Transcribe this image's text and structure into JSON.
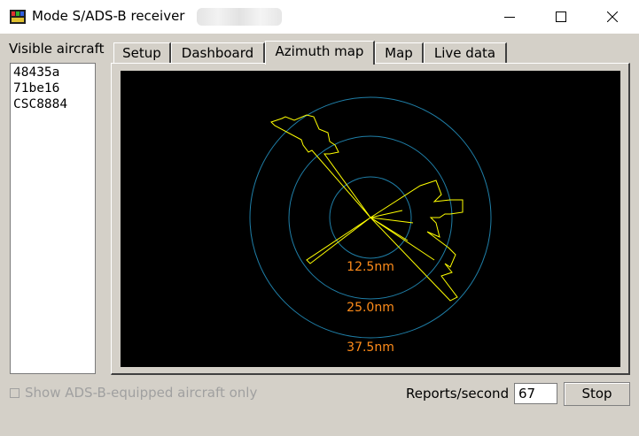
{
  "window": {
    "title": "Mode S/ADS-B receiver",
    "controls": [
      "minimize",
      "maximize",
      "close"
    ]
  },
  "sidebar": {
    "label": "Visible aircraft",
    "aircraft": [
      "48435a",
      "71be16",
      "CSC8884"
    ]
  },
  "tabs": [
    {
      "label": "Setup",
      "active": false
    },
    {
      "label": "Dashboard",
      "active": false
    },
    {
      "label": "Azimuth map",
      "active": true
    },
    {
      "label": "Map",
      "active": false
    },
    {
      "label": "Live data",
      "active": false
    }
  ],
  "azimuth_map": {
    "ring_labels": [
      "12.5nm",
      "25.0nm",
      "37.5nm"
    ],
    "colors": {
      "background": "#000000",
      "rings": "#1f7fa8",
      "trace": "#ffff00",
      "labels": "#ff8c1a"
    }
  },
  "footer": {
    "adsb_only_label": "Show ADS-B-equipped aircraft only",
    "adsb_only_checked": false,
    "reports_label": "Reports/second",
    "reports_value": "67",
    "stop_label": "Stop"
  }
}
